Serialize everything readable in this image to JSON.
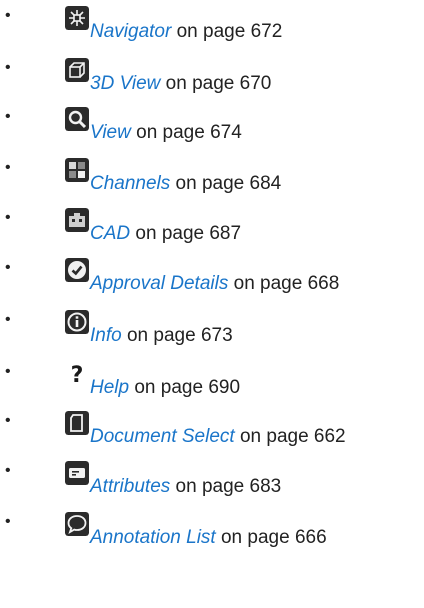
{
  "items": [
    {
      "icon": "navigator-icon",
      "link": "Navigator",
      "suffix": " on page 672"
    },
    {
      "icon": "3d-view-icon",
      "link": "3D View",
      "suffix": " on page 670"
    },
    {
      "icon": "view-icon",
      "link": "View",
      "suffix": " on page 674"
    },
    {
      "icon": "channels-icon",
      "link": "Channels",
      "suffix": " on page 684"
    },
    {
      "icon": "cad-icon",
      "link": "CAD",
      "suffix": " on page 687"
    },
    {
      "icon": "approval-details-icon",
      "link": "Approval Details",
      "suffix": " on page 668"
    },
    {
      "icon": "info-icon",
      "link": "Info",
      "suffix": " on page 673"
    },
    {
      "icon": "help-icon",
      "link": "Help",
      "suffix": " on page 690"
    },
    {
      "icon": "document-select-icon",
      "link": "Document Select",
      "suffix": " on page 662"
    },
    {
      "icon": "attributes-icon",
      "link": "Attributes",
      "suffix": " on page 683"
    },
    {
      "icon": "annotation-list-icon",
      "link": "Annotation List",
      "suffix": " on page 666"
    }
  ],
  "bullet": "•",
  "colors": {
    "link": "#1a75c9",
    "text": "#222222"
  }
}
